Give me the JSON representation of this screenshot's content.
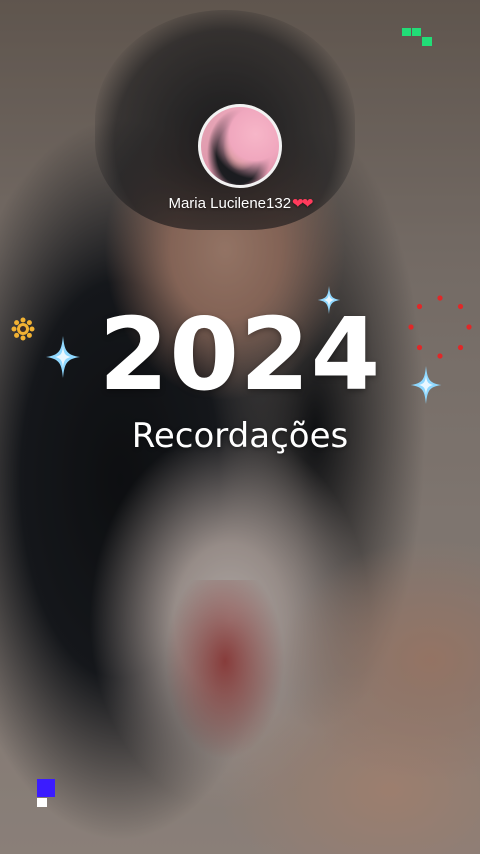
{
  "profile": {
    "username": "Maria Lucilene132",
    "hearts": "❤❤"
  },
  "recap": {
    "year": "2024",
    "subtitle": "Recordações"
  },
  "colors": {
    "accent_green": "#22dd77",
    "accent_blue": "#3b1cff",
    "sparkle_blue": "#8fd8ff",
    "ring_red": "#e02828",
    "gear_yellow": "#f2b233",
    "heart_red": "#ff3b5c"
  },
  "decorations": {
    "icons": [
      "sparkle-icon",
      "gear-icon",
      "dotted-ring-icon",
      "pixel-blocks-icon"
    ]
  }
}
